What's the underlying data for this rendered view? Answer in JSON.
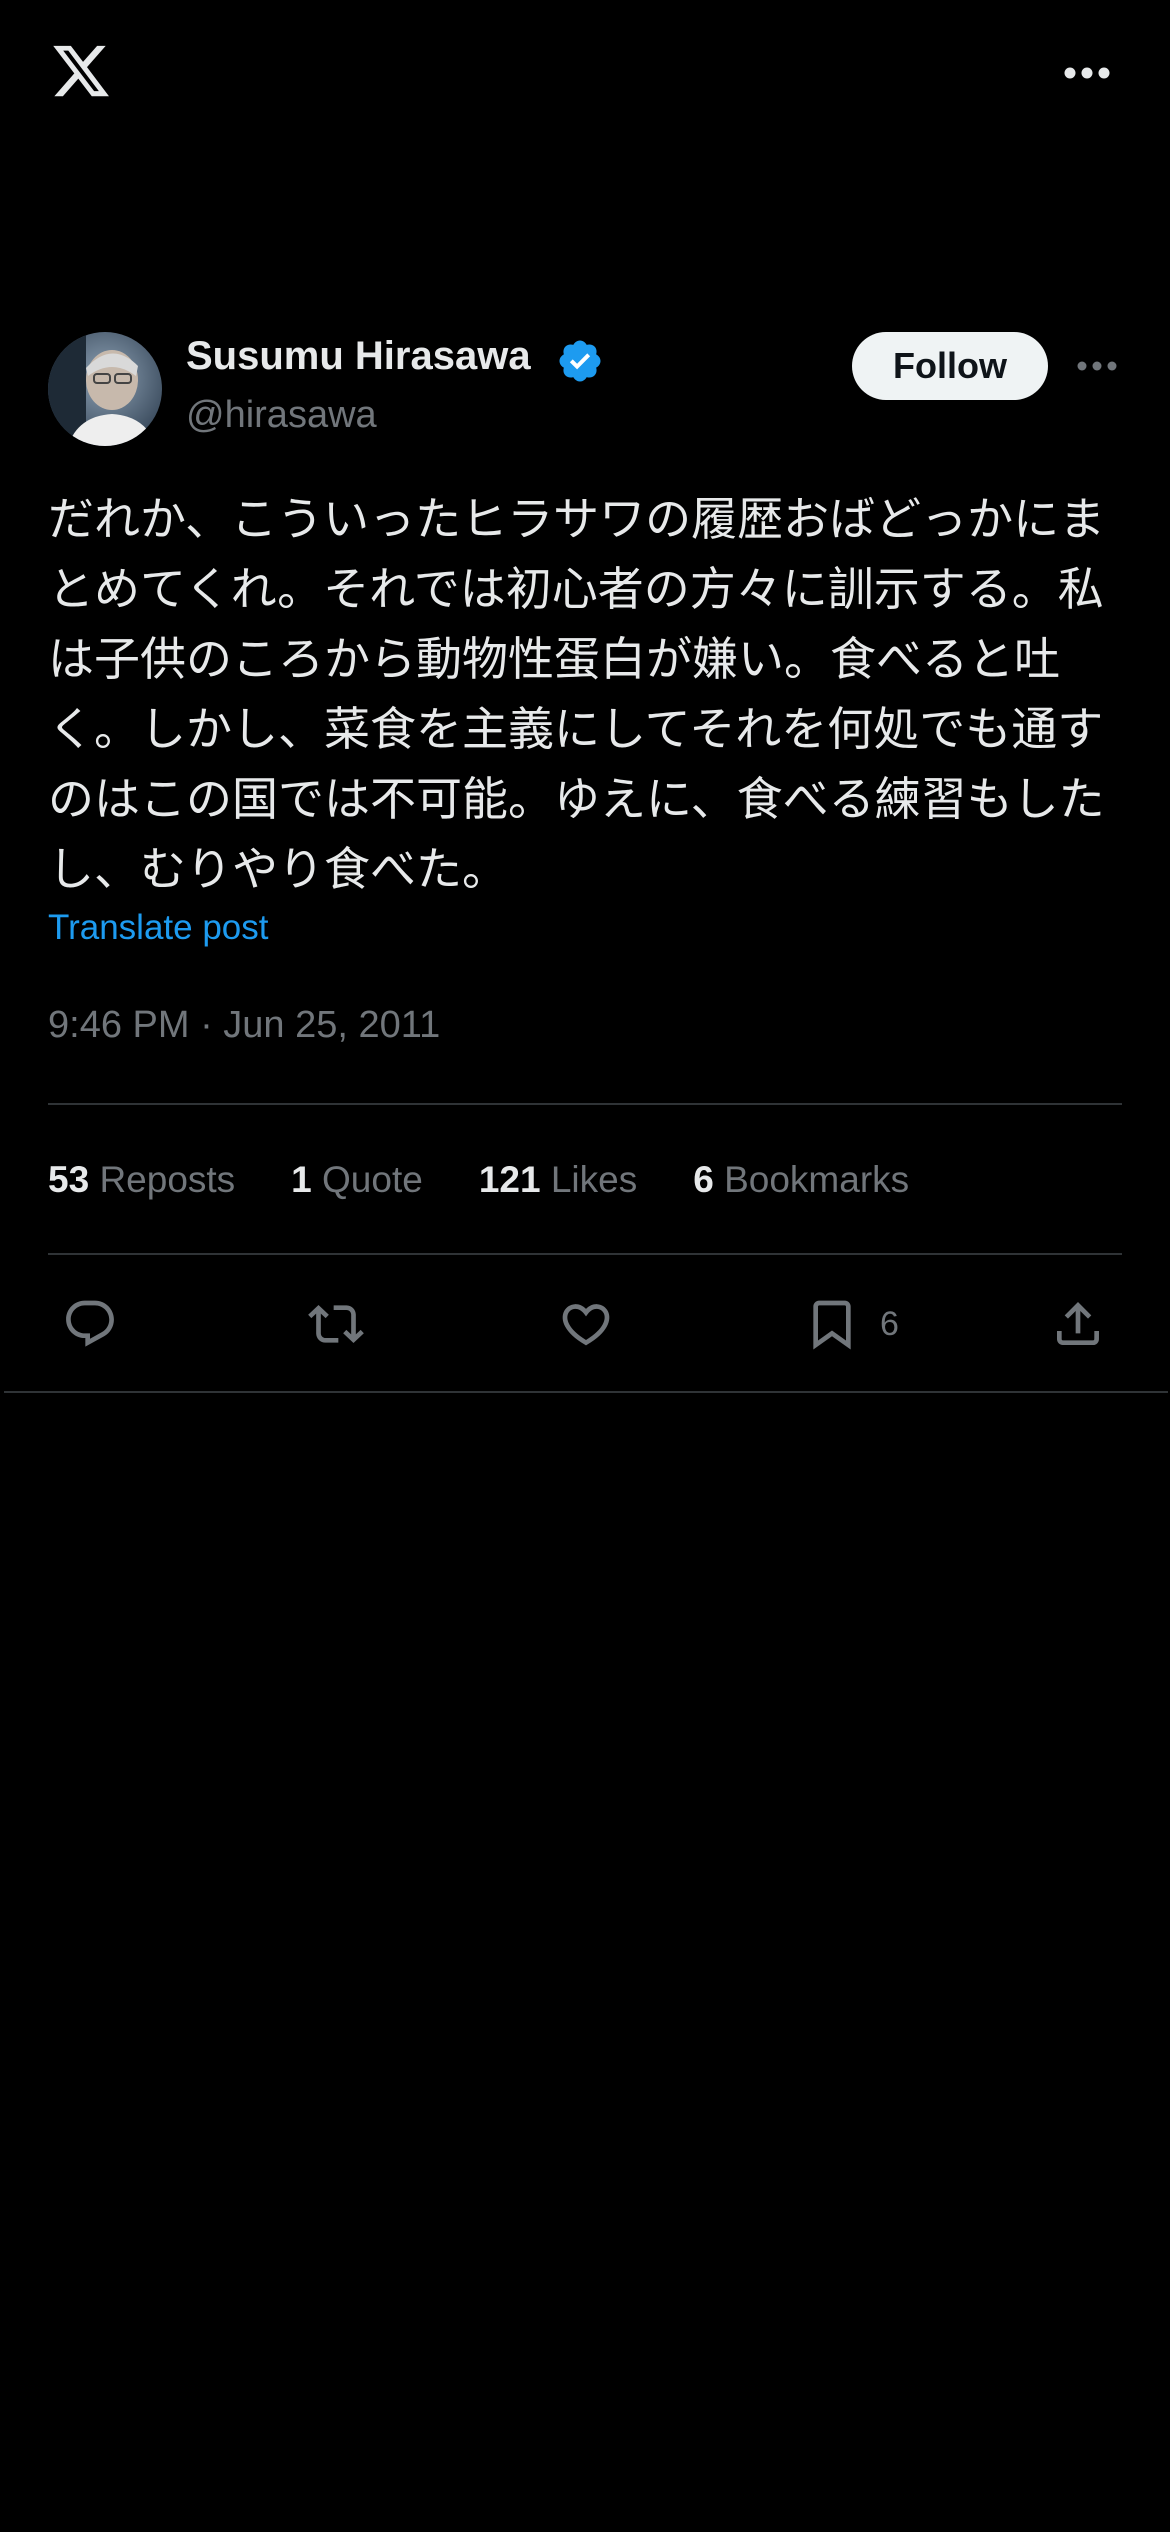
{
  "header": {
    "logo_icon": "x-logo-icon",
    "menu_icon": "more-horizontal-icon"
  },
  "post": {
    "author": {
      "display_name": "Susumu Hirasawa",
      "handle": "@hirasawa",
      "verified": true,
      "verified_color": "#1d9bf0"
    },
    "follow_label": "Follow",
    "text": "だれか、こういったヒラサワの履歴おばどっかにまとめてくれ。それでは初心者の方々に訓示する。私は子供のころから動物性蛋白が嫌い。食べると吐く。しかし、菜食を主義にしてそれを何処でも通すのはこの国では不可能。ゆえに、食べる練習もしたし、むりやり食べた。",
    "translate_label": "Translate post",
    "timestamp": "9:46 PM · Jun 25, 2011",
    "stats": {
      "reposts_count": "53",
      "reposts_label": "Reposts",
      "quotes_count": "1",
      "quotes_label": "Quote",
      "likes_count": "121",
      "likes_label": "Likes",
      "bookmarks_count": "6",
      "bookmarks_label": "Bookmarks"
    },
    "actions": {
      "reply_icon": "reply-icon",
      "repost_icon": "repost-icon",
      "like_icon": "heart-icon",
      "bookmark_icon": "bookmark-icon",
      "bookmark_count": "6",
      "share_icon": "share-icon"
    }
  },
  "colors": {
    "background": "#000000",
    "text": "#e7e9ea",
    "secondary_text": "#71767b",
    "accent": "#1d9bf0",
    "divider": "#2f3336"
  }
}
